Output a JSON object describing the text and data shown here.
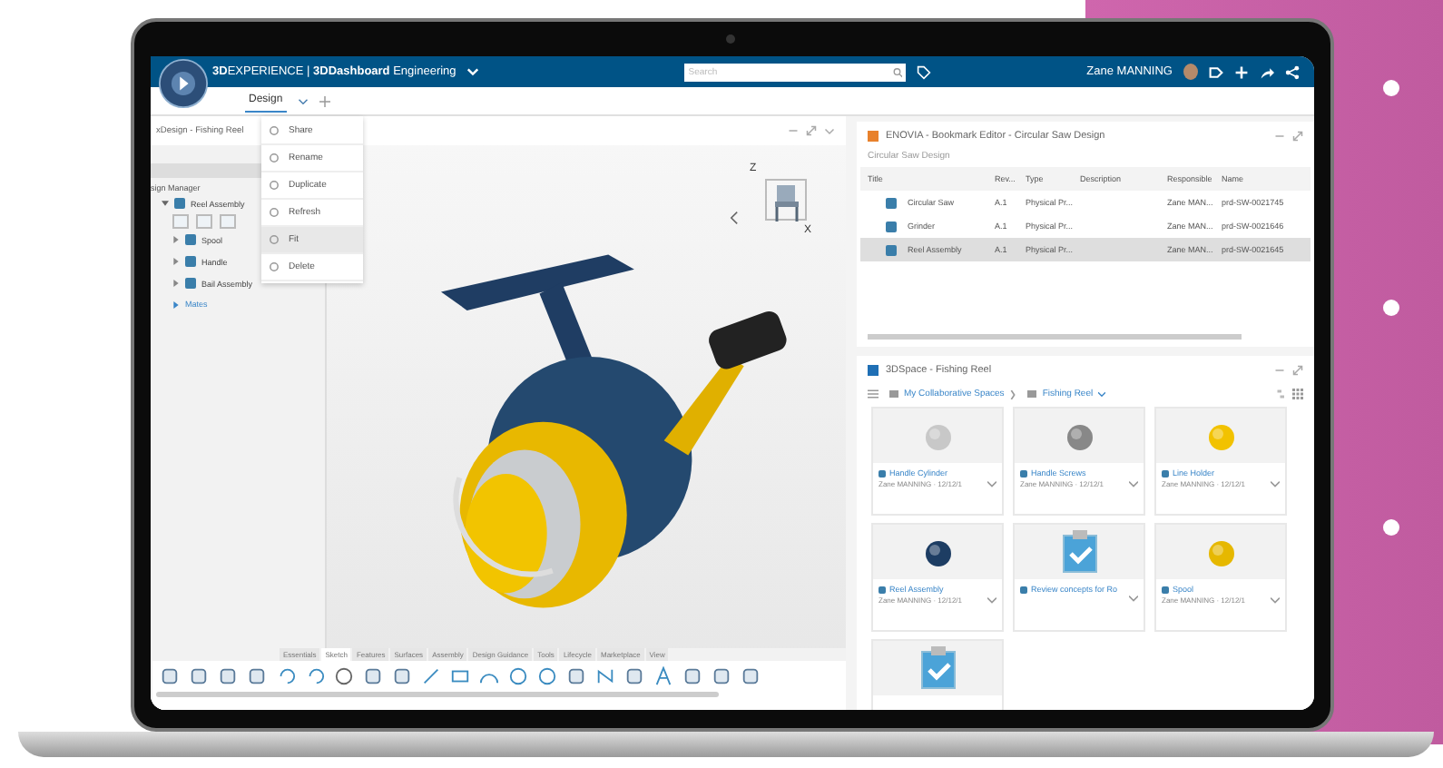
{
  "top_bar": {
    "title": "**3D**EXPERIENCE | **3DDashboard** Engineering",
    "search": {
      "placeholder": "Search"
    },
    "user": "Zane MANNING"
  },
  "tabs": [
    {
      "label": "Design",
      "selected": true
    }
  ],
  "design_app": {
    "title": "xDesign - Fishing Reel",
    "tree_heading": "sign Manager",
    "tree": [
      {
        "label": "Reel Assembly",
        "expanded": true,
        "children": [
          {
            "label": "Spool",
            "expanded": false
          },
          {
            "label": "Handle",
            "expanded": false
          },
          {
            "label": "Bail Assembly",
            "expanded": false
          },
          {
            "label": "Mates",
            "expanded": false
          }
        ]
      }
    ],
    "context_menu": [
      {
        "label": "Share",
        "selected": false
      },
      {
        "label": "Rename",
        "selected": false
      },
      {
        "label": "Duplicate",
        "selected": false
      },
      {
        "label": "Refresh",
        "selected": false
      },
      {
        "label": "Fit",
        "selected": true
      },
      {
        "label": "Delete",
        "selected": false
      }
    ],
    "axis_labels": [
      "Z",
      "X"
    ],
    "toolbar_tabs": [
      {
        "label": "Essentials",
        "selected": false
      },
      {
        "label": "Sketch",
        "selected": true
      },
      {
        "label": "Features",
        "selected": false
      },
      {
        "label": "Surfaces",
        "selected": false
      },
      {
        "label": "Assembly",
        "selected": false
      },
      {
        "label": "Design Guidance",
        "selected": false
      },
      {
        "label": "Tools",
        "selected": false
      },
      {
        "label": "Lifecycle",
        "selected": false
      },
      {
        "label": "Marketplace",
        "selected": false
      },
      {
        "label": "View",
        "selected": false
      }
    ]
  },
  "bookmark_editor": {
    "title": "ENOVIA - Bookmark Editor - Circular Saw Design",
    "subtitle": "Circular Saw Design",
    "columns": [
      "Title",
      "Rev...",
      "Type",
      "Description",
      "Responsible",
      "Name"
    ],
    "rows": [
      {
        "cells": [
          "Circular Saw",
          "A.1",
          "Physical Pr...",
          "",
          "Zane MAN...",
          "prd-SW-0021745"
        ],
        "selected": false
      },
      {
        "cells": [
          "Grinder",
          "A.1",
          "Physical Pr...",
          "",
          "Zane MAN...",
          "prd-SW-0021646"
        ],
        "selected": false
      },
      {
        "cells": [
          "Reel Assembly",
          "A.1",
          "Physical Pr...",
          "",
          "Zane MAN...",
          "prd-SW-0021645"
        ],
        "selected": true
      }
    ]
  },
  "space": {
    "title": "3DSpace - Fishing Reel",
    "breadcrumb": [
      "My Collaborative Spaces",
      "Fishing Reel"
    ],
    "cards": [
      {
        "kind": "part",
        "title": "Handle Cylinder",
        "meta": "Zane MANNING · 12/12/1"
      },
      {
        "kind": "part",
        "title": "Handle Screws",
        "meta": "Zane MANNING · 12/12/1"
      },
      {
        "kind": "part",
        "title": "Line Holder",
        "meta": "Zane MANNING · 12/12/1"
      },
      {
        "kind": "part",
        "title": "Reel Assembly",
        "meta": "Zane MANNING · 12/12/1"
      },
      {
        "kind": "task",
        "title": "Review concepts for Ro"
      },
      {
        "kind": "part",
        "title": "Spool",
        "meta": "Zane MANNING · 12/12/1"
      },
      {
        "kind": "task"
      }
    ]
  }
}
